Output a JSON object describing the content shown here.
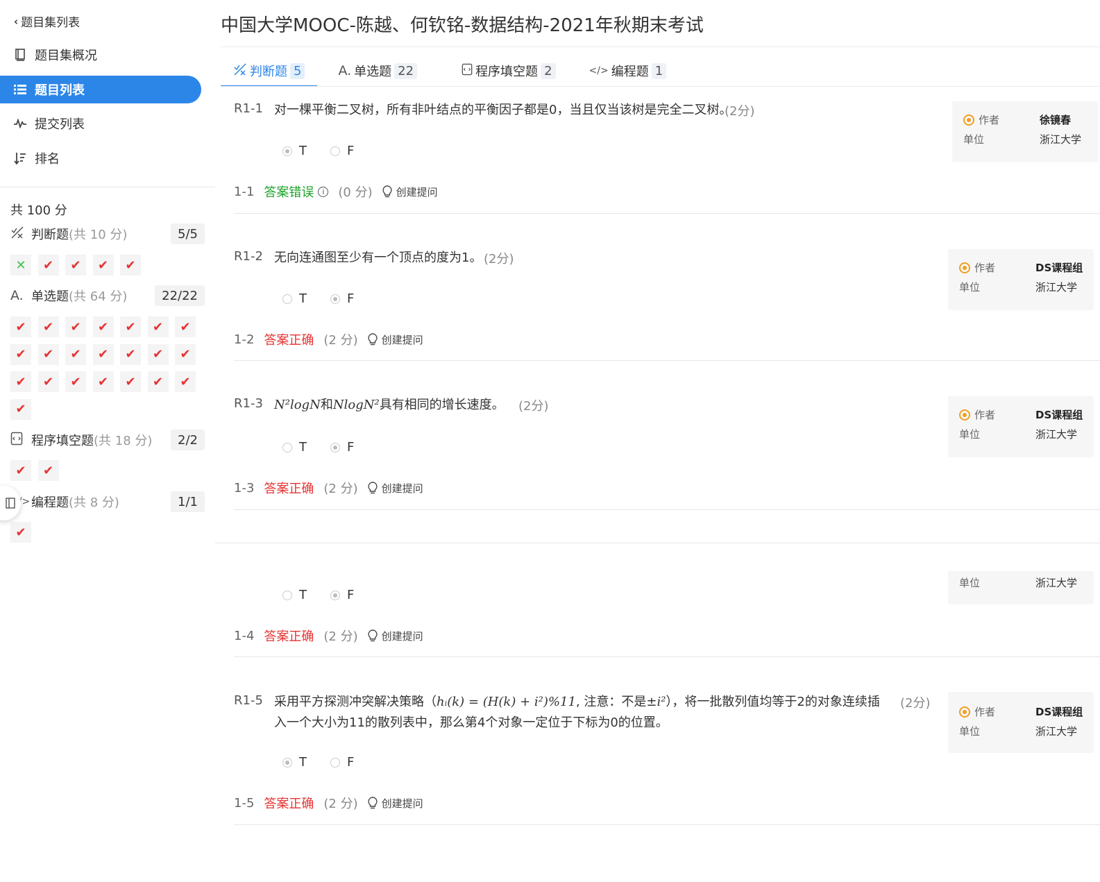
{
  "sidebar": {
    "back_label": "题目集列表",
    "nav": [
      {
        "label": "题目集概况",
        "icon": "book-icon"
      },
      {
        "label": "题目列表",
        "icon": "list-icon",
        "active": true
      },
      {
        "label": "提交列表",
        "icon": "pulse-icon"
      },
      {
        "label": "排名",
        "icon": "sort-icon"
      }
    ],
    "total": "共 100 分",
    "sections": [
      {
        "name": "判断题",
        "points": "(共 10 分)",
        "badge": "5/5",
        "icon": "judge-icon"
      },
      {
        "name": "单选题",
        "points": "(共 64 分)",
        "badge": "22/22",
        "icon": "choice-icon"
      },
      {
        "name": "程序填空题",
        "points": "(共 18 分)",
        "badge": "2/2",
        "icon": "fill-icon"
      },
      {
        "name": "编程题",
        "points": "(共 8 分)",
        "badge": "1/1",
        "icon": "code-icon"
      }
    ]
  },
  "main": {
    "title": "中国大学MOOC-陈越、何钦铭-数据结构-2021年秋期末考试",
    "tabs": [
      {
        "label": "判断题",
        "count": "5",
        "icon_glyph": "⁒"
      },
      {
        "label": "单选题",
        "count": "22",
        "icon_glyph": "A."
      },
      {
        "label": "程序填空题",
        "count": "2",
        "icon_glyph": "▣"
      },
      {
        "label": "编程题",
        "count": "1",
        "icon_glyph": "</>"
      }
    ],
    "questions": [
      {
        "id": "R1-1",
        "text": "对一棵平衡二叉树，所有非叶结点的平衡因子都是0，当且仅当该树是完全二叉树。",
        "score": "(2分)",
        "opt_t": "T",
        "opt_f": "F",
        "selected": "T",
        "rnum": "1-1",
        "status": "答案错误",
        "rpts": "(0 分)",
        "ask": "创建提问",
        "author_label": "作者",
        "author": "徐镜春",
        "unit_label": "单位",
        "unit": "浙江大学"
      },
      {
        "id": "R1-2",
        "text": "无向连通图至少有一个顶点的度为1。",
        "score": "(2分)",
        "opt_t": "T",
        "opt_f": "F",
        "selected": "F",
        "rnum": "1-2",
        "status": "答案正确",
        "rpts": "(2 分)",
        "ask": "创建提问",
        "author_label": "作者",
        "author": "DS课程组",
        "unit_label": "单位",
        "unit": "浙江大学"
      },
      {
        "id": "R1-3",
        "text_math1": "N²logN",
        "text_and": "和",
        "text_math2": "NlogN²",
        "text_rest": "具有相同的增长速度。",
        "score": "(2分)",
        "opt_t": "T",
        "opt_f": "F",
        "selected": "F",
        "rnum": "1-3",
        "status": "答案正确",
        "rpts": "(2 分)",
        "ask": "创建提问",
        "author_label": "作者",
        "author": "DS课程组",
        "unit_label": "单位",
        "unit": "浙江大学"
      },
      {
        "opt_t": "T",
        "opt_f": "F",
        "selected": "F",
        "rnum": "1-4",
        "status": "答案正确",
        "rpts": "(2 分)",
        "ask": "创建提问",
        "unit_label": "单位",
        "unit": "浙江大学"
      },
      {
        "id": "R1-5",
        "text_a": "采用平方探测冲突解决策略（",
        "text_math": "hᵢ(k) = (H(k) + i²)%11",
        "text_b": ", 注意：不是±",
        "text_math_b": "i²",
        "text_c": "），将一批散列值均等于2的对象连续插入一个大小为11的散列表中，那么第4个对象一定位于下标为0的位置。",
        "score": "(2分)",
        "opt_t": "T",
        "opt_f": "F",
        "selected": "T",
        "rnum": "1-5",
        "status": "答案正确",
        "rpts": "(2 分)",
        "ask": "创建提问",
        "author_label": "作者",
        "author": "DS课程组",
        "unit_label": "单位",
        "unit": "浙江大学"
      }
    ]
  },
  "colors": {
    "accent": "#2c86e8",
    "correct": "#e63333",
    "wrong": "#1ea32a",
    "medal": "#f0a020"
  }
}
